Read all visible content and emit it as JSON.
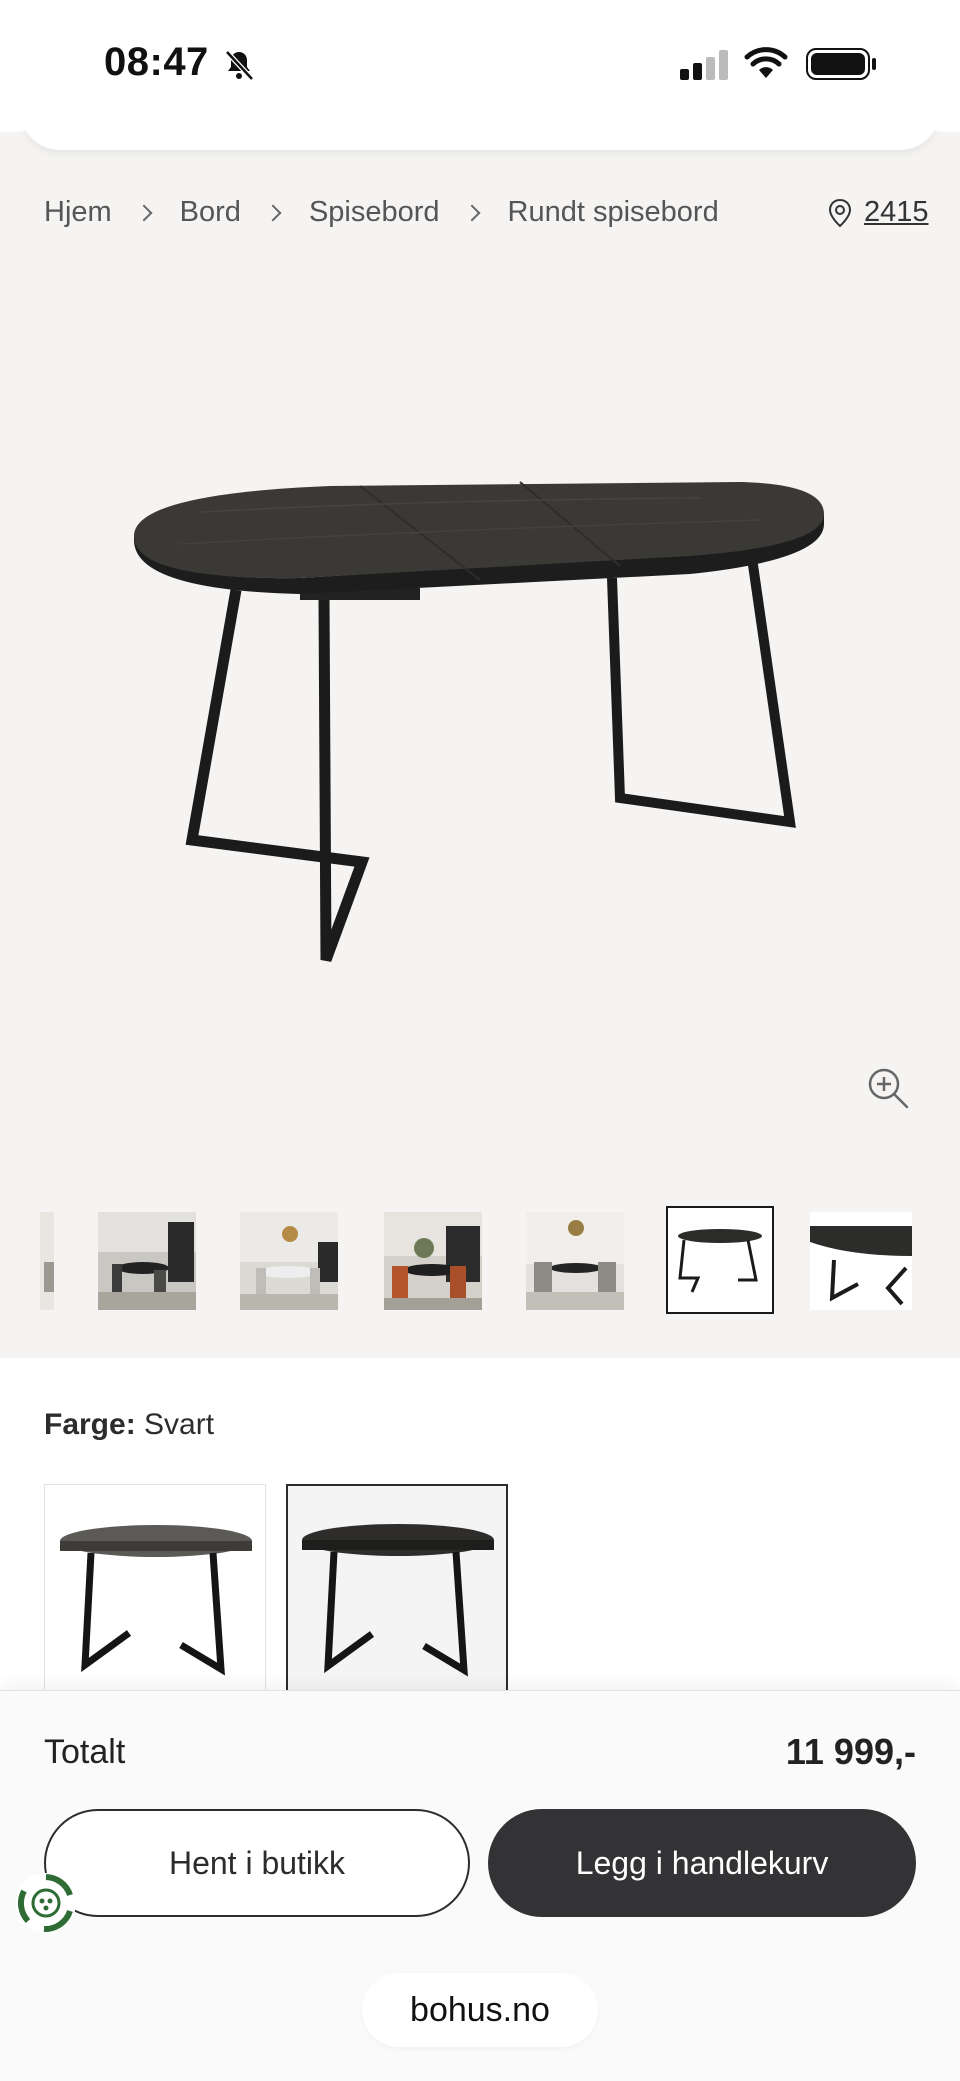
{
  "status_bar": {
    "time": "08:47"
  },
  "breadcrumb": [
    {
      "label": "Hjem"
    },
    {
      "label": "Bord"
    },
    {
      "label": "Spisebord"
    },
    {
      "label": "Rundt spisebord"
    }
  ],
  "store": {
    "code": "2415",
    "icon": "location-pin-icon"
  },
  "product": {
    "color_label": "Farge:",
    "color_value": "Svart"
  },
  "footer": {
    "total_label": "Totalt",
    "total_price": "11 999,-",
    "pickup_label": "Hent i butikk",
    "cart_label": "Legg i handlekurv",
    "url": "bohus.no"
  },
  "colors": {
    "primary_button": "#333336",
    "eco_green": "#2e6b35"
  }
}
